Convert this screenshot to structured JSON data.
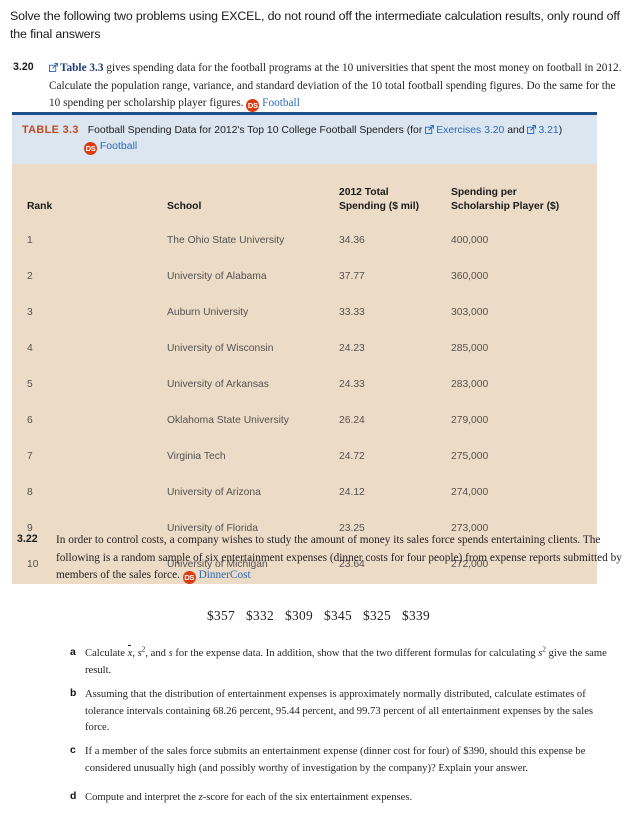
{
  "instruction": "Solve the following two problems using EXCEL, do not round off the intermediate calculation results, only round off the final answers",
  "exercise_320": {
    "number": "3.20",
    "link_label": "Table 3.3",
    "text_part1": " gives spending data for the football programs at the 10 universities that spent the most money on football in 2012. Calculate the population range, variance, and standard deviation of the 10 total football spending figures. Do the same for the 10 spending per scholarship player figures. ",
    "ds_badge": "DS",
    "dataset_label": "Football"
  },
  "table": {
    "label": "TABLE 3.3",
    "caption_part1": "Football Spending Data for 2012's Top 10 College Football Spenders (for ",
    "caption_link1": "Exercises 3.20",
    "caption_and": " and ",
    "caption_link2": "3.21",
    "caption_close": ")",
    "ds_badge": "DS",
    "dataset_label": "Football",
    "columns": [
      "Rank",
      "School",
      "2012 Total\nSpending ($ mil)",
      "Spending per\nScholarship Player ($)"
    ],
    "col_spend_line1": "2012 Total",
    "col_spend_line2": "Spending ($ mil)",
    "col_schol_line1": "Spending per",
    "col_schol_line2": "Scholarship Player ($)",
    "rows": [
      {
        "rank": "1",
        "school": "The Ohio State University",
        "spending": "34.36",
        "per_player": "400,000"
      },
      {
        "rank": "2",
        "school": "University of Alabama",
        "spending": "37.77",
        "per_player": "360,000"
      },
      {
        "rank": "3",
        "school": "Auburn University",
        "spending": "33.33",
        "per_player": "303,000"
      },
      {
        "rank": "4",
        "school": "University of Wisconsin",
        "spending": "24.23",
        "per_player": "285,000"
      },
      {
        "rank": "5",
        "school": "University of Arkansas",
        "spending": "24.33",
        "per_player": "283,000"
      },
      {
        "rank": "6",
        "school": "Oklahoma State University",
        "spending": "26.24",
        "per_player": "279,000"
      },
      {
        "rank": "7",
        "school": "Virginia Tech",
        "spending": "24.72",
        "per_player": "275,000"
      },
      {
        "rank": "8",
        "school": "University of Arizona",
        "spending": "24.12",
        "per_player": "274,000"
      },
      {
        "rank": "9",
        "school": "University of Florida",
        "spending": "23.25",
        "per_player": "273,000"
      },
      {
        "rank": "10",
        "school": "University of Michigan",
        "spending": "23.64",
        "per_player": "272,000"
      }
    ]
  },
  "exercise_322": {
    "number": "3.22",
    "text": "In order to control costs, a company wishes to study the amount of money its sales force spends entertaining clients. The following is a random sample of six entertainment expenses (dinner costs for four people) from expense reports submitted by members of the sales force. ",
    "ds_badge": "DS",
    "dataset_label": "DinnerCost",
    "expense_values": [
      "$357",
      "$332",
      "$309",
      "$345",
      "$325",
      "$339"
    ],
    "parts": [
      {
        "letter": "a",
        "text_pre": "Calculate ",
        "text_post": " for the expense data. In addition, show that the two different formulas for calculating s² give the same result."
      },
      {
        "letter": "b",
        "text": "Assuming that the distribution of entertainment expenses is approximately normally distributed, calculate estimates of tolerance intervals containing 68.26 percent, 95.44 percent, and 99.73 percent of all entertainment expenses by the sales force."
      },
      {
        "letter": "c",
        "text": "If a member of the sales force submits an entertainment expense (dinner cost for four) of $390, should this expense be considered unusually high (and possibly worthy of investigation by the company)? Explain your answer."
      },
      {
        "letter": "d",
        "text_pre": "Compute and interpret the ",
        "text_mid": "z",
        "text_post": "-score for each of the six entertainment expenses."
      }
    ]
  },
  "colors": {
    "rule_blue": "#1f4e8c",
    "caption_bg": "#dce6f1",
    "table_body_bg": "#ecdbc6",
    "table_label_orange": "#c0491e",
    "link_blue": "#2b6cb8",
    "ds_badge_red": "#d93c11"
  }
}
